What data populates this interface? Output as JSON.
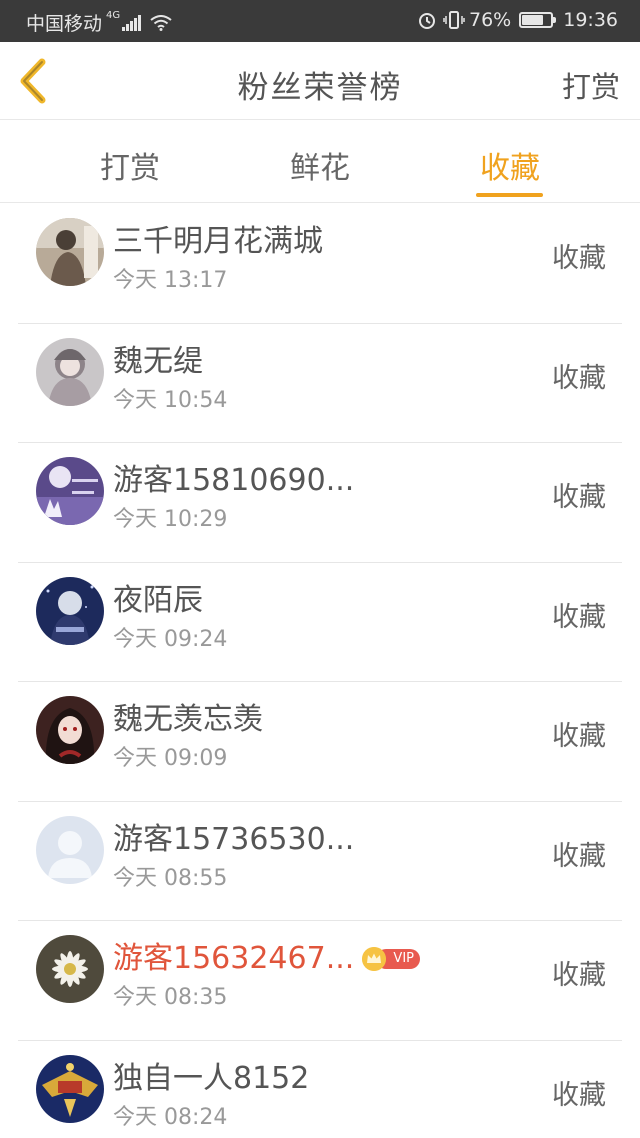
{
  "status_bar": {
    "carrier": "中国移动",
    "network": "4G",
    "battery_percent_text": "76%",
    "battery_level": 0.76,
    "time": "19:36"
  },
  "header": {
    "back_icon": "chevron-left-icon",
    "title": "粉丝荣誉榜",
    "right_action": "打赏"
  },
  "tabs": [
    {
      "label": "打赏",
      "active": false
    },
    {
      "label": "鲜花",
      "active": false
    },
    {
      "label": "收藏",
      "active": true
    }
  ],
  "colors": {
    "accent": "#f0a21e",
    "vip_name": "#e0553b"
  },
  "list": [
    {
      "name": "三千明月花满城",
      "time": "今天 13:17",
      "action": "收藏",
      "vip": false
    },
    {
      "name": "魏无缇",
      "time": "今天 10:54",
      "action": "收藏",
      "vip": false
    },
    {
      "name": "游客15810690...",
      "time": "今天 10:29",
      "action": "收藏",
      "vip": false
    },
    {
      "name": "夜陌辰",
      "time": "今天 09:24",
      "action": "收藏",
      "vip": false
    },
    {
      "name": "魏无羡忘羡",
      "time": "今天 09:09",
      "action": "收藏",
      "vip": false
    },
    {
      "name": "游客15736530...",
      "time": "今天 08:55",
      "action": "收藏",
      "vip": false
    },
    {
      "name": "游客15632467...",
      "time": "今天 08:35",
      "action": "收藏",
      "vip": true,
      "badge": "VIP"
    },
    {
      "name": "独自一人8152",
      "time": "今天 08:24",
      "action": "收藏",
      "vip": false
    }
  ]
}
